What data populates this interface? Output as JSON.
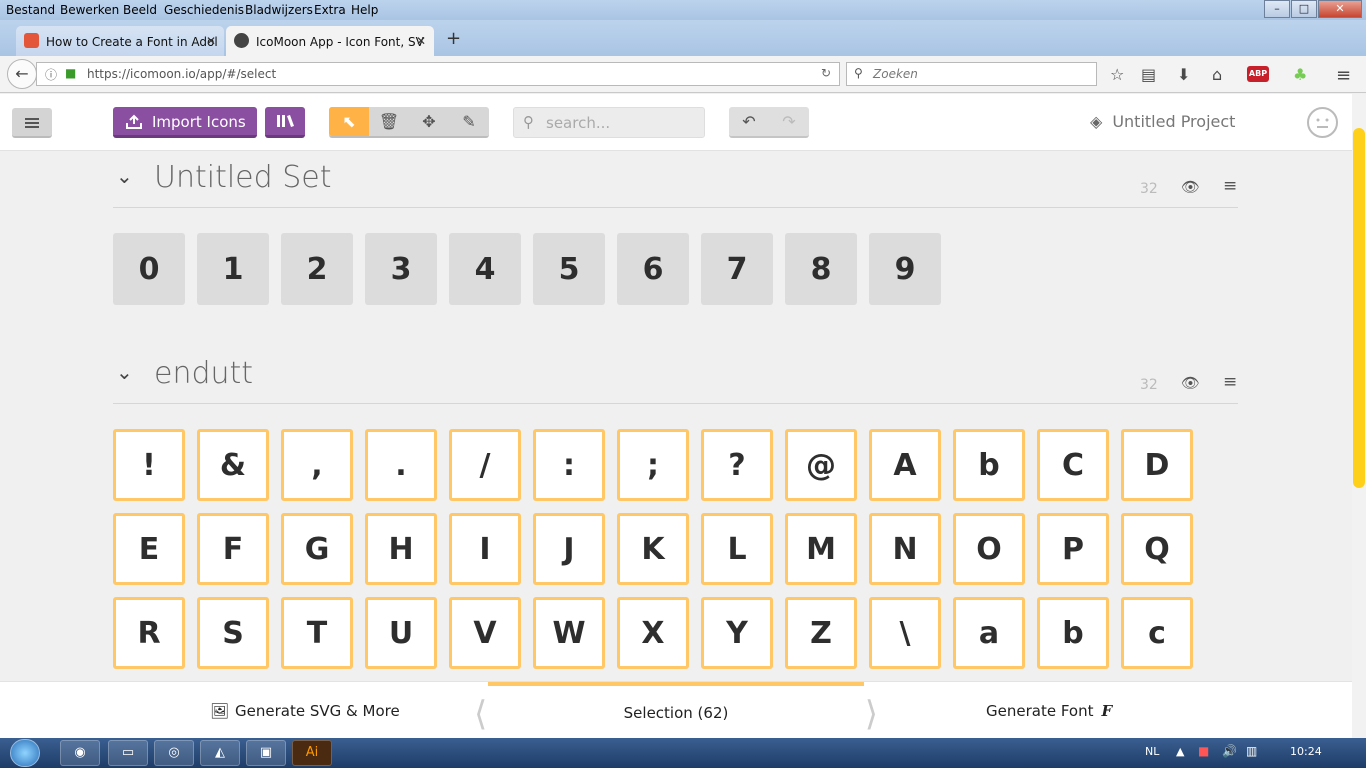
{
  "browser": {
    "menu": [
      "Bestand",
      "Bewerken",
      "Beeld",
      "Geschiedenis",
      "Bladwijzers",
      "Extra",
      "Help"
    ],
    "tabs": [
      {
        "title": "How to Create a Font in Adol",
        "active": false
      },
      {
        "title": "IcoMoon App - Icon Font, SV",
        "active": true
      }
    ],
    "url": "https://icomoon.io/app/#/select",
    "search_placeholder": "Zoeken",
    "new_tab": "+",
    "window_buttons": [
      "–",
      "□",
      "✕"
    ]
  },
  "app": {
    "import_label": "Import Icons",
    "search_placeholder": "search...",
    "project_name": "Untitled Project"
  },
  "sets": [
    {
      "title": "Untitled Set",
      "count": "32",
      "icons": [
        "0",
        "1",
        "2",
        "3",
        "4",
        "5",
        "6",
        "7",
        "8",
        "9"
      ]
    },
    {
      "title": "endutt",
      "count": "32",
      "icons": [
        "!",
        "&",
        ",",
        ".",
        "/",
        ":",
        ";",
        "?",
        "@",
        "A",
        "b",
        "C",
        "D",
        "E",
        "F",
        "G",
        "H",
        "I",
        "J",
        "K",
        "L",
        "M",
        "N",
        "O",
        "P",
        "Q",
        "R",
        "S",
        "T",
        "U",
        "V",
        "W",
        "X",
        "Y",
        "Z",
        "\\",
        "a",
        "b",
        "c"
      ]
    }
  ],
  "bottom": {
    "generate_svg": "Generate SVG & More",
    "selection": "Selection (62)",
    "generate_font": "Generate Font"
  },
  "taskbar": {
    "lang": "NL",
    "time": "10:24"
  }
}
